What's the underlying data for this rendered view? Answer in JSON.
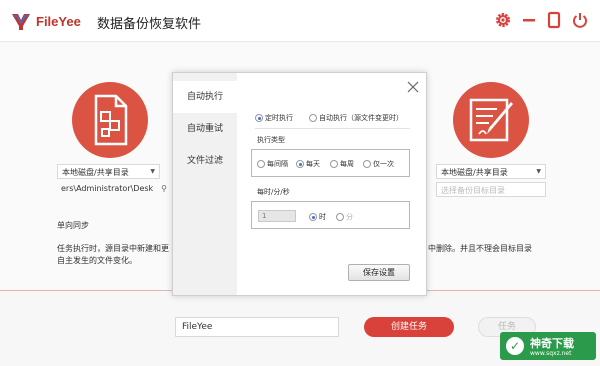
{
  "app": {
    "brand": "FileYee",
    "title": "数据备份恢复软件"
  },
  "colors": {
    "accent": "#d9423a",
    "circle": "#db5343"
  },
  "left_panel": {
    "source_type": "本地磁盘/共享目录",
    "source_path": "ers\\Administrator\\Desk",
    "sync_mode": "单向同步",
    "description_line1": "任务执行时，源目录中新建和更",
    "description_line2": "自主发生的文件变化。"
  },
  "right_panel": {
    "target_type": "本地磁盘/共享目录",
    "target_placeholder": "选择备份目标目录",
    "description_line1": "中删除。并且不理会目标目录"
  },
  "bottom": {
    "task_name": "FileYee",
    "create_button": "创建任务",
    "secondary_button": "任务"
  },
  "dialog": {
    "tabs": [
      "自动执行",
      "自动重试",
      "文件过滤"
    ],
    "mode_options": [
      "定时执行",
      "自动执行（源文件变更时）"
    ],
    "exec_type_label": "执行类型",
    "exec_type_options": [
      "每间隔",
      "每天",
      "每周",
      "仅一次"
    ],
    "time_label": "每时/分/秒",
    "time_value": "1",
    "unit_options": [
      "时",
      "分"
    ],
    "save_button": "保存设置"
  },
  "watermark": {
    "logo_char": "✓",
    "main": "神奇下载",
    "sub": "www.sqxz.net"
  }
}
